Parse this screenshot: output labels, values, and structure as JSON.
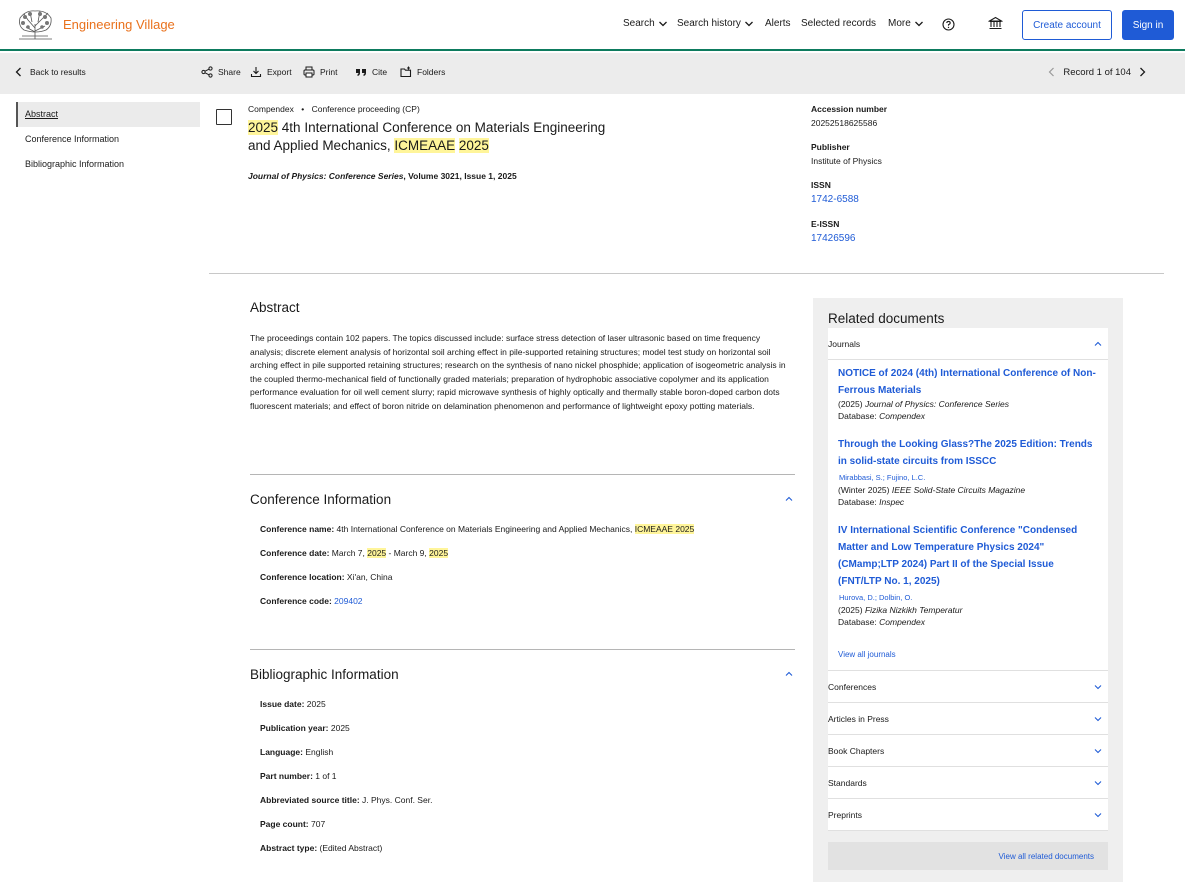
{
  "header": {
    "brand": "Engineering Village",
    "nav": {
      "search": "Search",
      "search_history": "Search history",
      "alerts": "Alerts",
      "selected_records": "Selected records",
      "more": "More"
    },
    "create_account": "Create account",
    "sign_in": "Sign in"
  },
  "toolbar": {
    "back": "Back to results",
    "share": "Share",
    "export": "Export",
    "print": "Print",
    "cite": "Cite",
    "folders": "Folders",
    "record_position": "Record 1 of 104"
  },
  "toc": {
    "abstract": "Abstract",
    "conference": "Conference Information",
    "bibliographic": "Bibliographic Information"
  },
  "record": {
    "database": "Compendex",
    "bullet": "•",
    "doc_type": "Conference proceeding (CP)",
    "title_1": "2025",
    "title_2": " 4th International Conference on Materials Engineering and Applied Mechanics, ",
    "title_3": "ICMEAAE",
    "title_4": " ",
    "title_5": "2025",
    "source_journal": "Journal of Physics: Conference Series",
    "source_rest": ", Volume 3021, Issue 1, 2025"
  },
  "side_meta": {
    "accession_label": "Accession number",
    "accession_value": "20252518625586",
    "publisher_label": "Publisher",
    "publisher_value": "Institute of Physics",
    "issn_label": "ISSN",
    "issn_value": "1742-6588",
    "eissn_label": "E-ISSN",
    "eissn_value": "17426596"
  },
  "abstract": {
    "heading": "Abstract",
    "text": "The proceedings contain 102 papers. The topics discussed include: surface stress detection of laser ultrasonic based on time frequency analysis; discrete element analysis of horizontal soil arching effect in pile-supported retaining structures; model test study on horizontal soil arching effect in pile supported retaining structures; research on the synthesis of nano nickel phosphide; application of isogeometric analysis in the coupled thermo-mechanical field of functionally graded materials; preparation of hydrophobic associative copolymer and its application performance evaluation for oil well cement slurry; rapid microwave synthesis of highly optically and thermally stable boron-doped carbon dots fluorescent materials; and effect of boron nitride on delamination phenomenon and performance of lightweight epoxy potting materials."
  },
  "conference": {
    "heading": "Conference Information",
    "name_label": "Conference name:",
    "name_value": " 4th International Conference on Materials Engineering and Applied Mechanics, ",
    "name_hl1": "ICMEAAE",
    "name_sp": " ",
    "name_hl2": "2025",
    "date_label": "Conference date:",
    "date_a": " March 7, ",
    "date_hl1": "2025",
    "date_b": " - March 9, ",
    "date_hl2": "2025",
    "location_label": "Conference location:",
    "location_value": " Xi'an, China",
    "code_label": "Conference code:",
    "code_value": "209402"
  },
  "bibliographic": {
    "heading": "Bibliographic Information",
    "issue_date_label": "Issue date:",
    "issue_date_value": " 2025",
    "pub_year_label": "Publication year:",
    "pub_year_value": " 2025",
    "language_label": "Language:",
    "language_value": " English",
    "part_label": "Part number:",
    "part_value": " 1 of 1",
    "abbr_label": "Abbreviated source title:",
    "abbr_value": " J. Phys. Conf. Ser.",
    "pages_label": "Page count:",
    "pages_value": " 707",
    "abstract_type_label": "Abstract type:",
    "abstract_type_value": " (Edited Abstract)"
  },
  "related": {
    "heading": "Related documents",
    "journals_label": "Journals",
    "docs": [
      {
        "title": "NOTICE of 2024 (4th) International Conference of Non-Ferrous Materials",
        "year": "(2025) ",
        "journal": "Journal of Physics: Conference Series",
        "db_label": "Database: ",
        "db": "Compendex"
      },
      {
        "title": "Through the Looking Glass?The 2025 Edition: Trends in solid-state circuits from ISSCC",
        "authors": "Mirabbasi, S.; Fujino, L.C.",
        "year": "(Winter 2025) ",
        "journal": "IEEE Solid-State Circuits Magazine",
        "db_label": "Database: ",
        "db": "Inspec"
      },
      {
        "title": "IV International Scientific Conference \"Condensed Matter and Low Temperature Physics 2024\" (CMamp;LTP 2024) Part II of the Special Issue (FNT/LTP No. 1, 2025)",
        "authors": "Hurova, D.; Dolbin, O.",
        "year": "(2025) ",
        "journal": "Fizika Nizkikh Temperatur",
        "db_label": "Database: ",
        "db": "Compendex"
      }
    ],
    "view_all_journals": "View all journals",
    "categories": [
      "Conferences",
      "Articles in Press",
      "Book Chapters",
      "Standards",
      "Preprints"
    ],
    "view_all": "View all related documents"
  }
}
